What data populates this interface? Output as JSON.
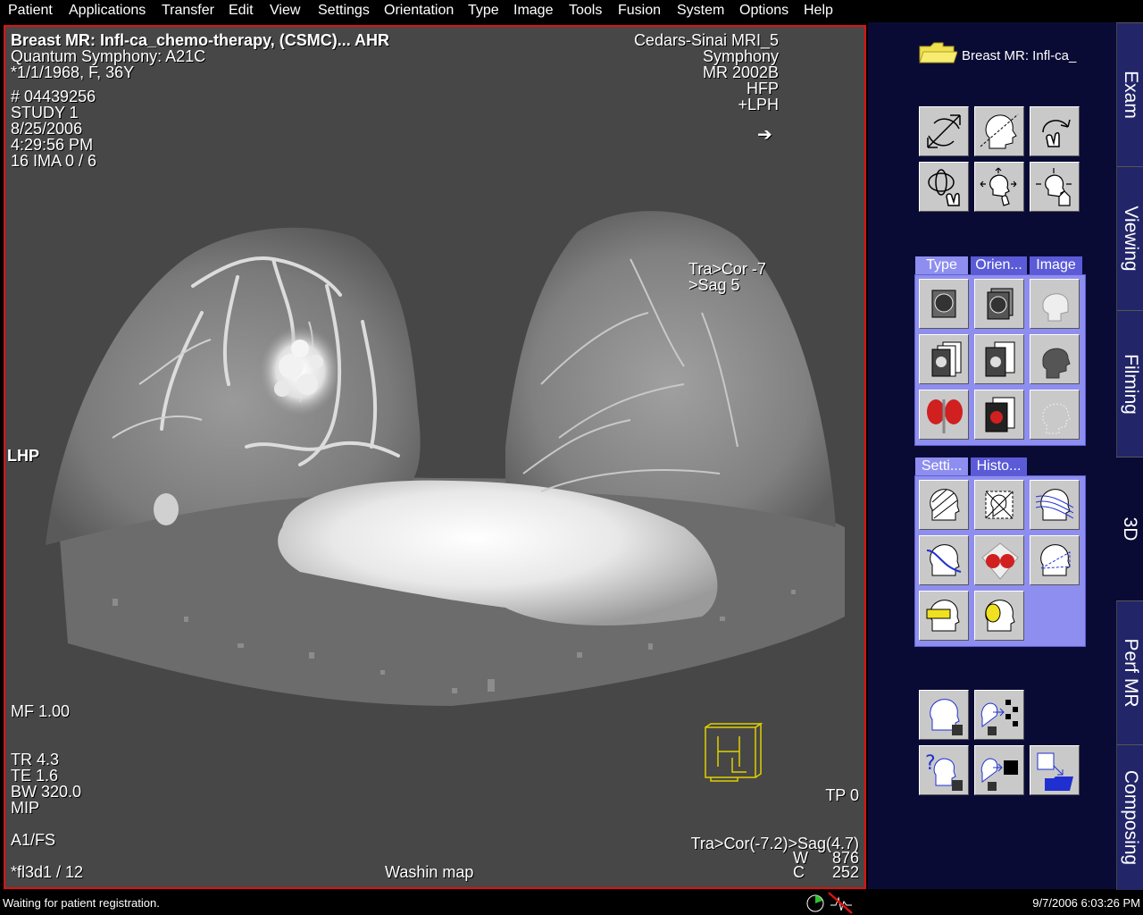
{
  "menu": [
    "Patient",
    "Applications",
    "Transfer",
    "Edit",
    "View",
    "Settings",
    "Orientation",
    "Type",
    "Image",
    "Tools",
    "Fusion",
    "System",
    "Options",
    "Help"
  ],
  "overlay": {
    "title": "Breast MR: Infl-ca_chemo-therapy, (CSMC)... AHR",
    "system": "Quantum Symphony: A21C",
    "dob": "*1/1/1968, F, 36Y",
    "patient_id": "# 04439256",
    "study": "STUDY 1",
    "date": "8/25/2006",
    "time": "4:29:56 PM",
    "ima": "16 IMA 0 / 6",
    "institution": "Cedars-Sinai MRI_5",
    "model": "Symphony",
    "mr": "MR 2002B",
    "hfp": "HFP",
    "lph": "+LPH",
    "arrow": "➔",
    "tra_cor": "Tra>Cor  -7",
    "sag": ">Sag  5",
    "lhp": "LHP",
    "mf": "MF 1.00",
    "tr": "TR 4.3",
    "te": "TE 1.6",
    "bw": "BW 320.0",
    "mip": "MIP",
    "a1fs": "A1/FS",
    "seq": "*fl3d1 / 12",
    "washin": "Washin map",
    "tp": "TP 0",
    "orient": "Tra>Cor(-7.2)>Sag(4.7)",
    "w_label": "W",
    "w_value": "876",
    "c_label": "C",
    "c_value": "252"
  },
  "panel": {
    "folder_label": "Breast MR: Infl-ca_",
    "type_tabs": [
      "Type",
      "Orien...",
      "Image"
    ],
    "settings_tabs": [
      "Setti...",
      "Histo..."
    ]
  },
  "side_tabs": [
    "Exam",
    "Viewing",
    "Filming",
    "3D",
    "Perf MR",
    "Composing"
  ],
  "status": {
    "message": "Waiting for patient registration.",
    "datetime": "9/7/2006 6:03:26 PM"
  },
  "colors": {
    "frame": "#e01010",
    "panel_bg": "#0a0b35",
    "group_bg": "#8e8ef0",
    "tab_bg": "#5b5bd8",
    "folder": "#f0e050"
  }
}
